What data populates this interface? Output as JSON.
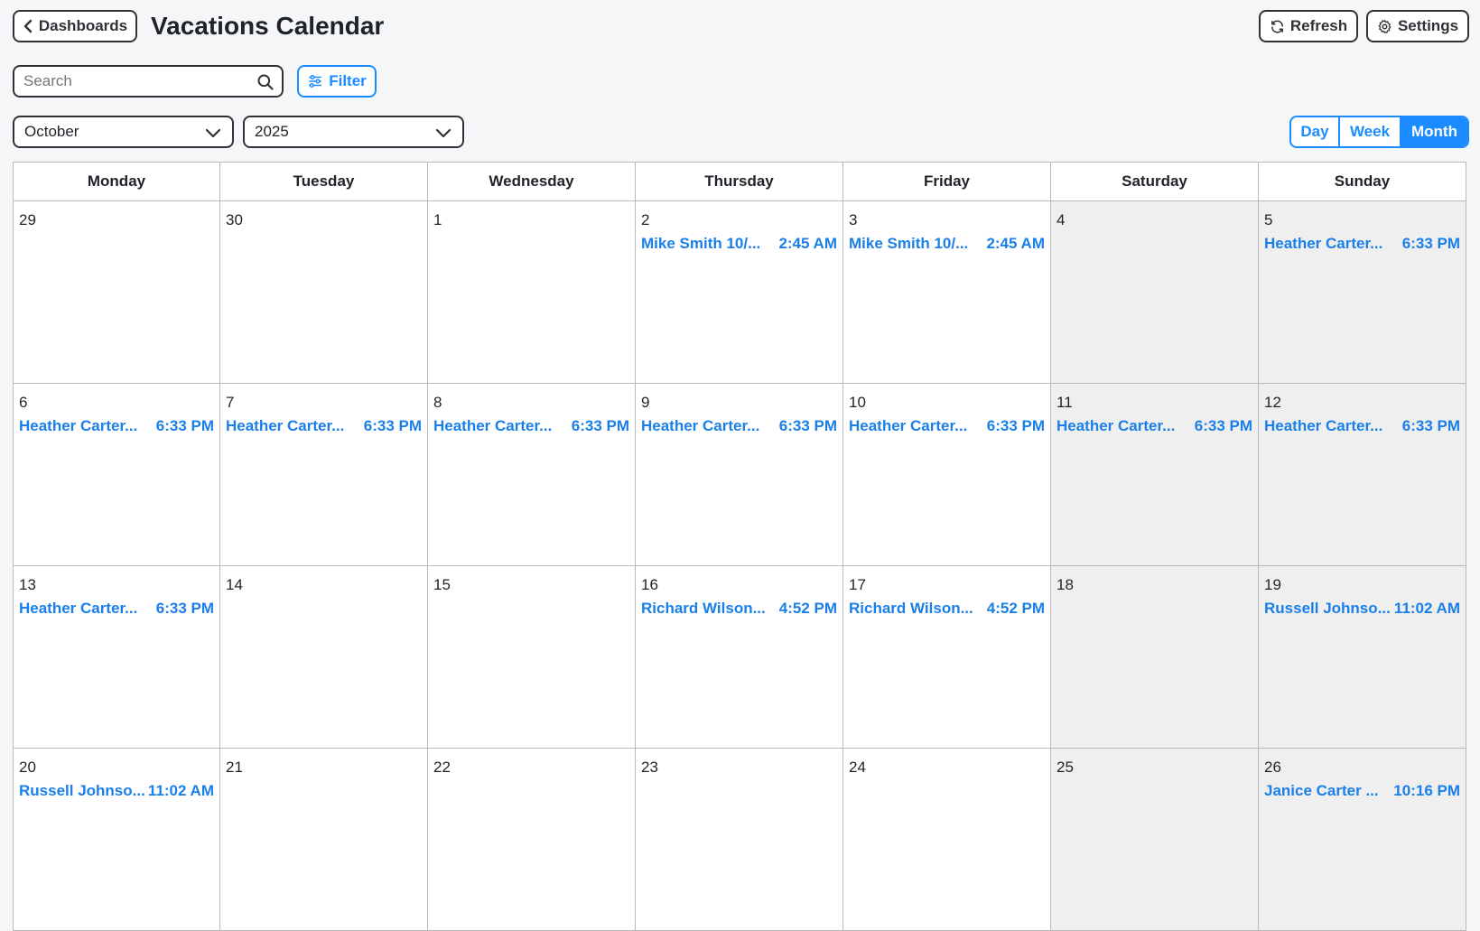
{
  "header": {
    "back_label": "Dashboards",
    "title": "Vacations Calendar",
    "refresh_label": "Refresh",
    "settings_label": "Settings"
  },
  "search": {
    "placeholder": "Search",
    "value": ""
  },
  "filter_label": "Filter",
  "month_select": "October",
  "year_select": "2025",
  "views": {
    "day": "Day",
    "week": "Week",
    "month": "Month",
    "active": "Month"
  },
  "accent_color": "#1a8cff",
  "weekdays": [
    "Monday",
    "Tuesday",
    "Wednesday",
    "Thursday",
    "Friday",
    "Saturday",
    "Sunday"
  ],
  "weeks": [
    [
      {
        "day": "29",
        "events": []
      },
      {
        "day": "30",
        "events": []
      },
      {
        "day": "1",
        "events": []
      },
      {
        "day": "2",
        "events": [
          {
            "title": "Mike Smith 10/...",
            "time": "2:45 AM"
          }
        ]
      },
      {
        "day": "3",
        "events": [
          {
            "title": "Mike Smith 10/...",
            "time": "2:45 AM"
          }
        ]
      },
      {
        "day": "4",
        "events": []
      },
      {
        "day": "5",
        "events": [
          {
            "title": "Heather Carter...",
            "time": "6:33 PM"
          }
        ]
      }
    ],
    [
      {
        "day": "6",
        "events": [
          {
            "title": "Heather Carter...",
            "time": "6:33 PM"
          }
        ]
      },
      {
        "day": "7",
        "events": [
          {
            "title": "Heather Carter...",
            "time": "6:33 PM"
          }
        ]
      },
      {
        "day": "8",
        "events": [
          {
            "title": "Heather Carter...",
            "time": "6:33 PM"
          }
        ]
      },
      {
        "day": "9",
        "events": [
          {
            "title": "Heather Carter...",
            "time": "6:33 PM"
          }
        ]
      },
      {
        "day": "10",
        "events": [
          {
            "title": "Heather Carter...",
            "time": "6:33 PM"
          }
        ]
      },
      {
        "day": "11",
        "events": [
          {
            "title": "Heather Carter...",
            "time": "6:33 PM"
          }
        ]
      },
      {
        "day": "12",
        "events": [
          {
            "title": "Heather Carter...",
            "time": "6:33 PM"
          }
        ]
      }
    ],
    [
      {
        "day": "13",
        "events": [
          {
            "title": "Heather Carter...",
            "time": "6:33 PM"
          }
        ]
      },
      {
        "day": "14",
        "events": []
      },
      {
        "day": "15",
        "events": []
      },
      {
        "day": "16",
        "events": [
          {
            "title": "Richard Wilson...",
            "time": "4:52 PM"
          }
        ]
      },
      {
        "day": "17",
        "events": [
          {
            "title": "Richard Wilson...",
            "time": "4:52 PM"
          }
        ]
      },
      {
        "day": "18",
        "events": []
      },
      {
        "day": "19",
        "events": [
          {
            "title": "Russell Johnso...",
            "time": "11:02 AM"
          }
        ]
      }
    ],
    [
      {
        "day": "20",
        "events": [
          {
            "title": "Russell Johnso...",
            "time": "11:02 AM"
          }
        ]
      },
      {
        "day": "21",
        "events": []
      },
      {
        "day": "22",
        "events": []
      },
      {
        "day": "23",
        "events": []
      },
      {
        "day": "24",
        "events": []
      },
      {
        "day": "25",
        "events": []
      },
      {
        "day": "26",
        "events": [
          {
            "title": "Janice Carter ...",
            "time": "10:16 PM"
          }
        ]
      }
    ]
  ]
}
